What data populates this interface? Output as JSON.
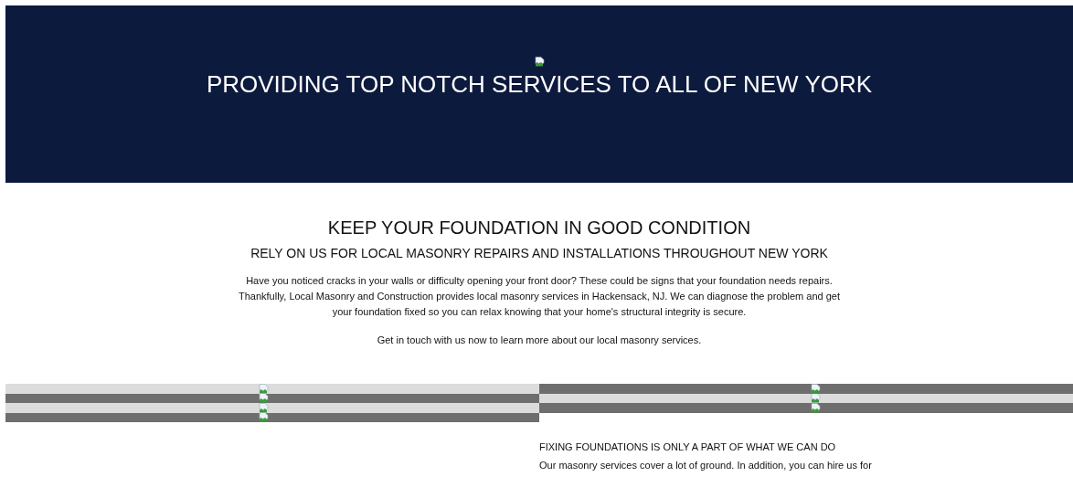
{
  "hero": {
    "title": "PROVIDING TOP NOTCH SERVICES TO ALL OF NEW YORK"
  },
  "intro": {
    "heading": "KEEP YOUR FOUNDATION IN GOOD CONDITION",
    "subheading": "RELY ON US FOR LOCAL MASONRY REPAIRS AND INSTALLATIONS THROUGHOUT NEW YORK",
    "paragraphs": [
      "Have you noticed cracks in your walls or difficulty opening your front door? These could be signs that your foundation needs repairs. Thankfully, Local Masonry and Construction provides local masonry services in Hackensack, NJ. We can diagnose the problem and get your foundation fixed so you can relax knowing that your home's structural integrity is secure.",
      "Get in touch with us now to learn more about our local masonry services."
    ]
  },
  "gallery": {
    "left": [
      {
        "kind": "light"
      },
      {
        "kind": "dark"
      },
      {
        "kind": "light"
      },
      {
        "kind": "dark"
      }
    ],
    "right": [
      {
        "kind": "dark"
      },
      {
        "kind": "light"
      },
      {
        "kind": "dark"
      }
    ]
  },
  "services": {
    "heading": "FIXING FOUNDATIONS IS ONLY A PART OF WHAT WE CAN DO",
    "paragraph": "Our masonry services cover a lot of ground. In addition, you can hire us for"
  }
}
